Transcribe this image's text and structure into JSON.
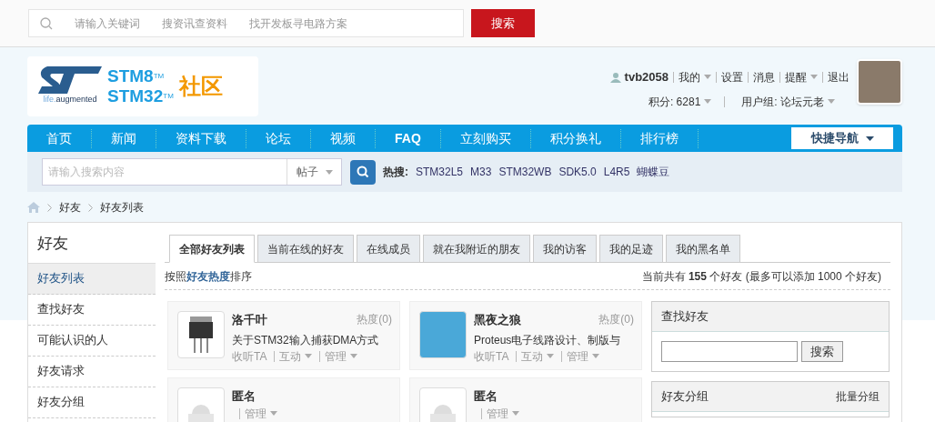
{
  "top_search": {
    "placeholders": [
      "请输入关键词",
      "搜资讯查资料",
      "找开发板寻电路方案"
    ],
    "button": "搜索"
  },
  "logo": {
    "tagline_a": "life.",
    "tagline_b": "augmented",
    "line1": "STM8",
    "line2": "STM32",
    "tm1": "TM",
    "tm2": "TM",
    "community": "社区"
  },
  "user": {
    "name": "tvb2058",
    "links": [
      {
        "label": "我的",
        "dropdown": true
      },
      {
        "label": "设置",
        "dropdown": false
      },
      {
        "label": "消息",
        "dropdown": false
      },
      {
        "label": "提醒",
        "dropdown": true
      },
      {
        "label": "退出",
        "dropdown": false
      }
    ],
    "points": "积分: 6281",
    "group": "用户组: 论坛元老"
  },
  "nav": {
    "items": [
      {
        "label": "首页",
        "bold": false
      },
      {
        "label": "新闻",
        "bold": false
      },
      {
        "label": "资料下载",
        "bold": false
      },
      {
        "label": "论坛",
        "bold": false
      },
      {
        "label": "视频",
        "bold": false
      },
      {
        "label": "FAQ",
        "bold": true
      },
      {
        "label": "立刻购买",
        "bold": false
      },
      {
        "label": "积分换礼",
        "bold": false
      },
      {
        "label": "排行榜",
        "bold": false
      }
    ],
    "quick_nav": "快捷导航"
  },
  "search": {
    "placeholder": "请输入搜索内容",
    "scope": "帖子",
    "hot_label": "热搜:",
    "hot": [
      "STM32L5",
      "M33",
      "STM32WB",
      "SDK5.0",
      "L4R5",
      "蝴蝶豆"
    ]
  },
  "breadcrumb": [
    "好友",
    "好友列表"
  ],
  "sidebar": {
    "title": "好友",
    "items": [
      {
        "label": "好友列表",
        "selected": true
      },
      {
        "label": "查找好友",
        "selected": false
      },
      {
        "label": "可能认识的人",
        "selected": false
      },
      {
        "label": "好友请求",
        "selected": false
      },
      {
        "label": "好友分组",
        "selected": false
      }
    ]
  },
  "tabs": [
    {
      "label": "全部好友列表",
      "selected": true
    },
    {
      "label": "当前在线的好友",
      "selected": false
    },
    {
      "label": "在线成员",
      "selected": false
    },
    {
      "label": "就在我附近的朋友",
      "selected": false
    },
    {
      "label": "我的访客",
      "selected": false
    },
    {
      "label": "我的足迹",
      "selected": false
    },
    {
      "label": "我的黑名单",
      "selected": false
    }
  ],
  "sort_note": "按照**好友热度**排序",
  "count_note": "当前共有 **155** 个好友 (最多可以添加 1000 个好友)",
  "friends": [
    {
      "name": "洛千叶",
      "kind": "chip",
      "heat": "热度(0)",
      "status": "关于STM32输入捕获DMA方式",
      "actions": [
        {
          "label": "收听TA",
          "dropdown": false
        },
        {
          "label": "互动",
          "dropdown": true
        },
        {
          "label": "管理",
          "dropdown": true
        }
      ]
    },
    {
      "name": "黑夜之狼",
      "kind": "photo",
      "heat": "热度(0)",
      "status": "Proteus电子线路设计、制版与",
      "actions": [
        {
          "label": "收听TA",
          "dropdown": false
        },
        {
          "label": "互动",
          "dropdown": true
        },
        {
          "label": "管理",
          "dropdown": true
        }
      ]
    },
    {
      "name": "匿名",
      "kind": "anonymous",
      "actions": [
        {
          "label": "管理",
          "dropdown": true
        }
      ]
    },
    {
      "name": "匿名",
      "kind": "anonymous",
      "actions": [
        {
          "label": "管理",
          "dropdown": true
        }
      ]
    }
  ],
  "find_panel": {
    "title": "查找好友",
    "button": "搜索"
  },
  "group_panel": {
    "title": "好友分组",
    "link": "批量分组"
  }
}
